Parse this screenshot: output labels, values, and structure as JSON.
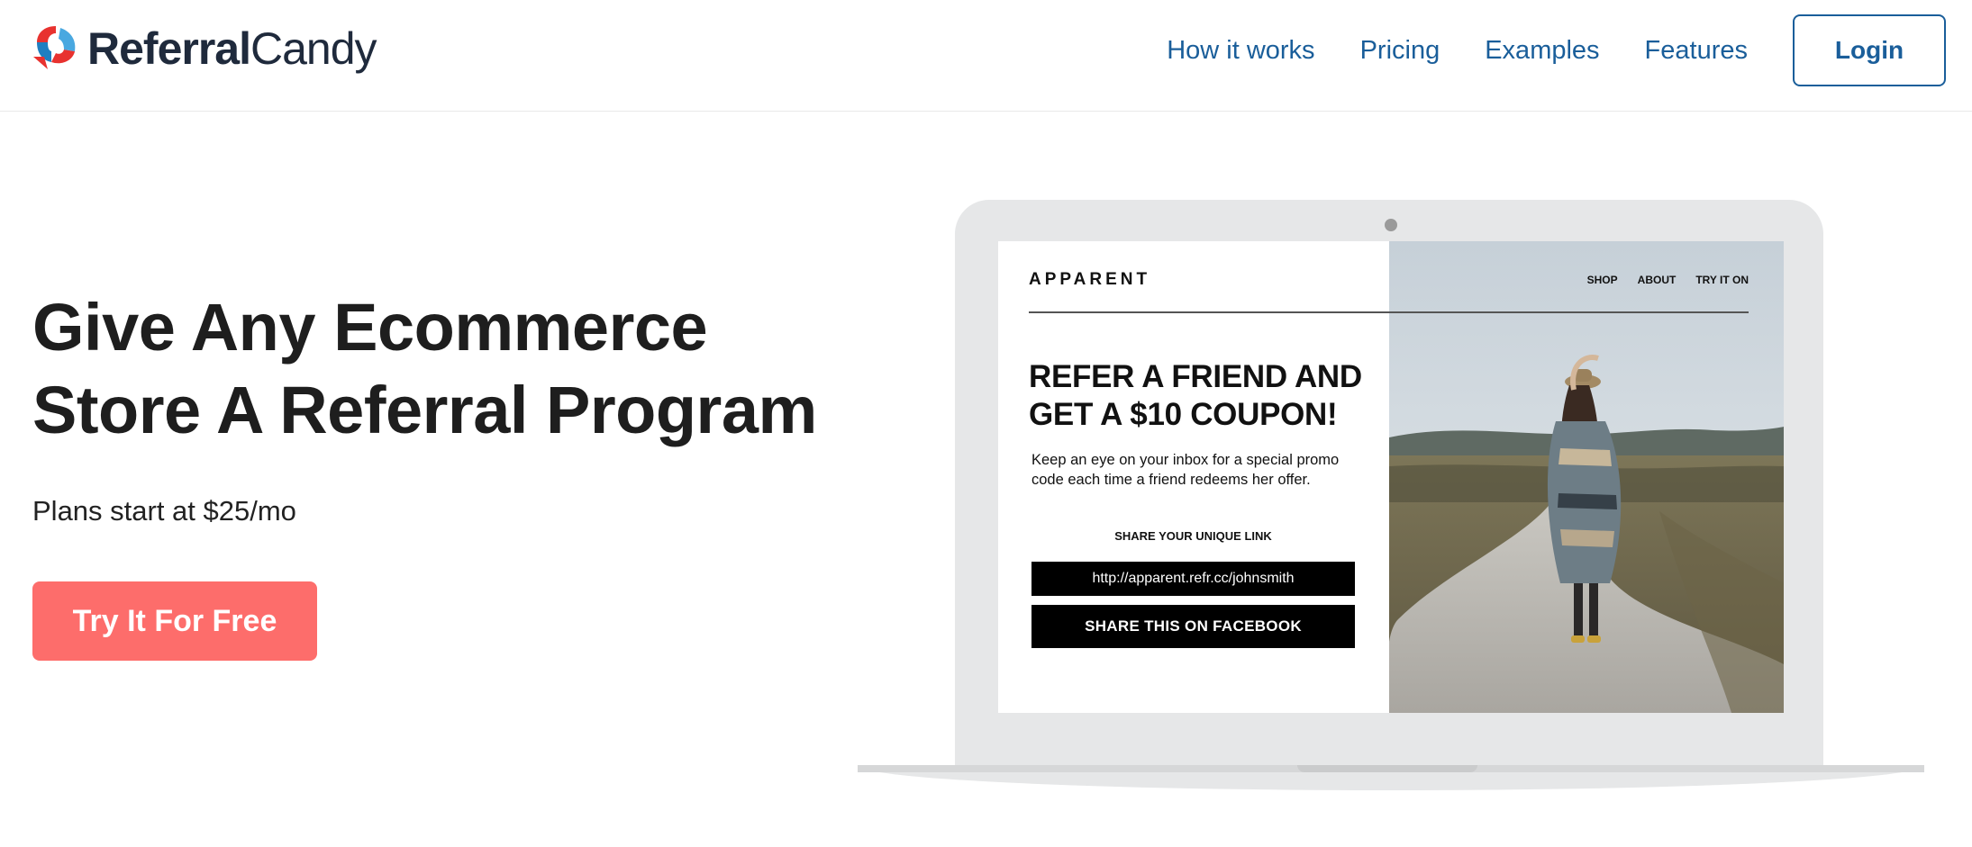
{
  "header": {
    "logo_text_bold": "Referral",
    "logo_text_light": "Candy",
    "nav": [
      {
        "label": "How it works"
      },
      {
        "label": "Pricing"
      },
      {
        "label": "Examples"
      },
      {
        "label": "Features"
      }
    ],
    "login_label": "Login"
  },
  "hero": {
    "title_line1": "Give Any Ecommerce",
    "title_line2": "Store A Referral Program",
    "subtitle": "Plans start at $25/mo",
    "cta_label": "Try It For Free"
  },
  "mockup": {
    "brand": "APPARENT",
    "nav": [
      {
        "label": "SHOP"
      },
      {
        "label": "ABOUT"
      },
      {
        "label": "TRY IT ON"
      }
    ],
    "headline_line1": "REFER A FRIEND AND",
    "headline_line2": "GET A $10 COUPON!",
    "body_line1": "Keep an eye on your inbox for a special promo",
    "body_line2": "code each time a friend redeems her offer.",
    "share_label": "SHARE YOUR UNIQUE LINK",
    "link_text": "http://apparent.refr.cc/johnsmith",
    "facebook_label": "SHARE THIS ON FACEBOOK"
  },
  "colors": {
    "nav_link": "#1a5e9a",
    "cta": "#fd6d6b",
    "laptop": "#e6e7e8"
  }
}
